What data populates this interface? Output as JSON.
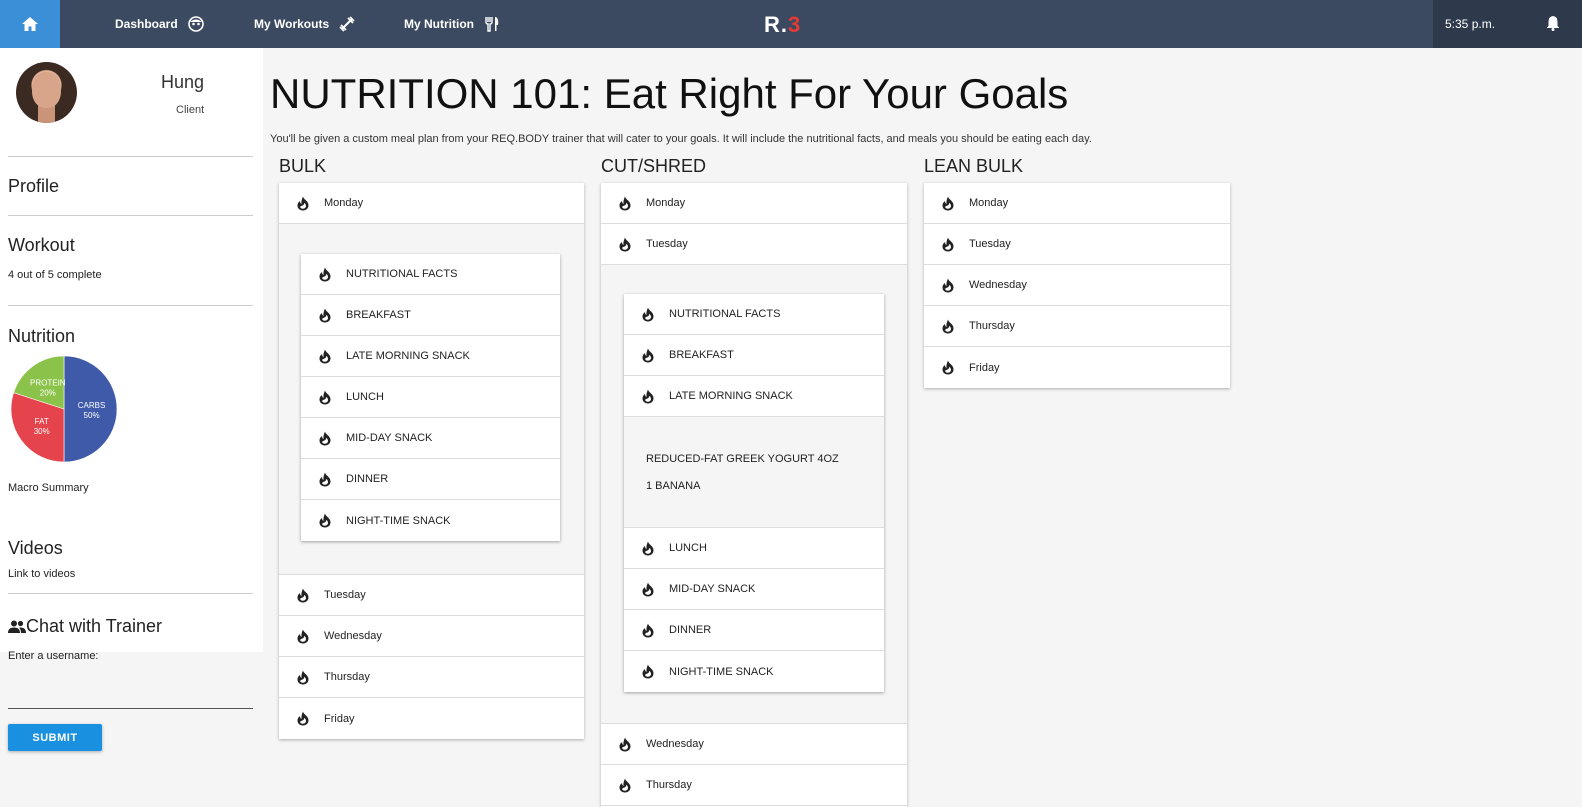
{
  "nav": {
    "items": [
      {
        "label": "Dashboard",
        "icon": "face-icon"
      },
      {
        "label": "My Workouts",
        "icon": "dumbbell-icon"
      },
      {
        "label": "My Nutrition",
        "icon": "utensils-icon"
      }
    ],
    "logo_main": "R.",
    "logo_accent": "3",
    "time": "5:35 p.m."
  },
  "sidebar": {
    "username": "Hung",
    "role": "Client",
    "profile": "Profile",
    "workout": "Workout",
    "workout_progress": "4 out of 5 complete",
    "nutrition": "Nutrition",
    "macro_summary": "Macro Summary",
    "videos": "Videos",
    "videos_link": "Link to videos",
    "chat_heading": "Chat with Trainer",
    "chat_label": "Enter a username:",
    "submit": "SUBMIT"
  },
  "chart_data": {
    "type": "pie",
    "slices": [
      {
        "label": "CARBS",
        "value": 50,
        "pct_label": "50%",
        "color": "#3f5aa9"
      },
      {
        "label": "FAT",
        "value": 30,
        "pct_label": "30%",
        "color": "#e6444c"
      },
      {
        "label": "PROTEIN",
        "value": 20,
        "pct_label": "20%",
        "color": "#8bc34a"
      }
    ]
  },
  "main": {
    "title": "NUTRITION 101: Eat Right For Your Goals",
    "intro": "You'll be given a custom meal plan from your REQ.BODY trainer that will cater to your goals. It will include the nutritional facts, and meals you should be eating each day.",
    "columns": [
      {
        "title": "BULK",
        "days": [
          "Monday",
          "Tuesday",
          "Wednesday",
          "Thursday",
          "Friday"
        ],
        "meals": [
          "NUTRITIONAL FACTS",
          "BREAKFAST",
          "LATE MORNING SNACK",
          "LUNCH",
          "MID-DAY SNACK",
          "DINNER",
          "NIGHT-TIME SNACK"
        ]
      },
      {
        "title": "CUT/SHRED",
        "days": [
          "Monday",
          "Tuesday",
          "Wednesday",
          "Thursday"
        ],
        "meals": [
          "NUTRITIONAL FACTS",
          "BREAKFAST",
          "LATE MORNING SNACK",
          "LUNCH",
          "MID-DAY SNACK",
          "DINNER",
          "NIGHT-TIME SNACK"
        ],
        "meal_items": [
          "REDUCED-FAT GREEK YOGURT 4OZ",
          "1 BANANA"
        ]
      },
      {
        "title": "LEAN BULK",
        "days": [
          "Monday",
          "Tuesday",
          "Wednesday",
          "Thursday",
          "Friday"
        ]
      }
    ]
  },
  "colors": {
    "topbar": "#3b4a60",
    "home": "#3a8fd6",
    "submit": "#1a90e0"
  }
}
